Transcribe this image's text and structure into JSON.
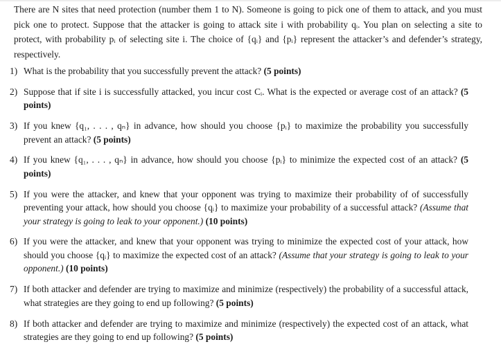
{
  "intro": {
    "text": "There are N sites that need protection (number them 1 to N). Someone is going to pick one of them to attack, and you must pick one to protect. Suppose that the attacker is going to attack site i with probability qᵢ. You plan on selecting a site to protect, with probability pᵢ of selecting site i. The choice of {qᵢ} and {pᵢ} represent the attacker’s and defender’s strategy, respectively."
  },
  "questions": [
    {
      "number": "1)",
      "text": "What is the probability that you successfully prevent the attack?",
      "note": "",
      "points": "(5 points)"
    },
    {
      "number": "2)",
      "text": "Suppose that if site i is successfully attacked, you incur cost Cᵢ. What is the expected or average cost of an attack?",
      "note": "",
      "points": "(5 points)"
    },
    {
      "number": "3)",
      "text": "If you knew {q₁, . . . , qₙ} in advance, how should you choose {pᵢ} to maximize the probability you successfully prevent an attack?",
      "note": "",
      "points": "(5 points)"
    },
    {
      "number": "4)",
      "text": "If you knew {q₁, . . . , qₙ} in advance, how should you choose {pᵢ} to minimize the expected cost of an attack?",
      "note": "",
      "points": "(5 points)"
    },
    {
      "number": "5)",
      "text": "If you were the attacker, and knew that your opponent was trying to maximize their probability of of successfully preventing your attack, how should you choose {qᵢ} to maximize your probability of a successful attack?",
      "note": "(Assume that your strategy is going to leak to your opponent.)",
      "points": "(10 points)"
    },
    {
      "number": "6)",
      "text": "If you were the attacker, and knew that your opponent was trying to minimize the expected cost of your attack, how should you choose {qᵢ} to maximize the expected cost of an attack?",
      "note": "(Assume that your strategy is going to leak to your opponent.)",
      "points": "(10 points)"
    },
    {
      "number": "7)",
      "text": "If both attacker and defender are trying to maximize and minimize (respectively) the probability of a successful attack, what strategies are they going to end up following?",
      "note": "",
      "points": "(5 points)"
    },
    {
      "number": "8)",
      "text": "If both attacker and defender are trying to maximize and minimize (respectively) the expected cost of an attack, what strategies are they going to end up following?",
      "note": "",
      "points": "(5 points)"
    }
  ]
}
